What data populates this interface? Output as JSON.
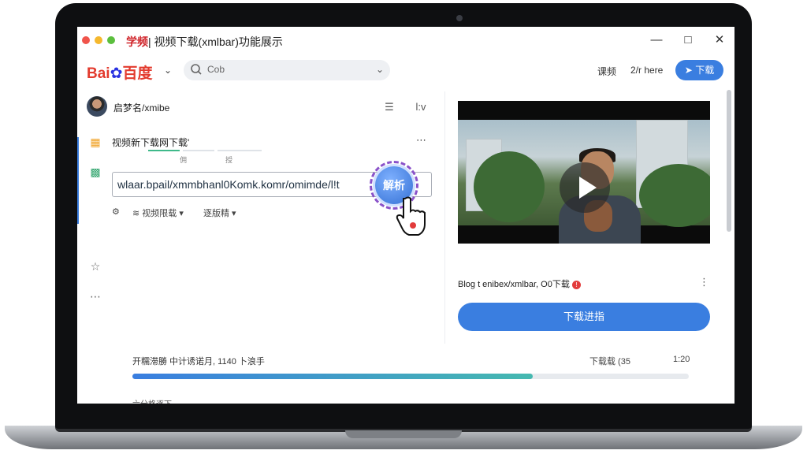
{
  "window": {
    "title_logo": "学频",
    "title": "| 视频下载(xmlbar)功能展示",
    "minimize_icon": "minimize-icon",
    "maximize_icon": "maximize-icon",
    "close_icon": "close-icon"
  },
  "nav": {
    "brand_left": "Bai",
    "brand_right": "百度",
    "search_text": "Cob",
    "link1": "课频",
    "link2": "2/r here",
    "download_label": "下载"
  },
  "user": {
    "name": "启梦名/xmibe",
    "action_right": "l:v"
  },
  "card": {
    "title": "视频新下载网下载'",
    "mini_label_1": "佣",
    "mini_label_2": "授",
    "url_value": "wlaar.bpail/xmmbhanl0Komk.komr/omimde/l!t",
    "parse_label": "解析",
    "option_1": "视频限载",
    "option_2": "逐版精"
  },
  "video": {
    "title": "Blog t enibex/xmlbar, O0下载",
    "download_progress_label": "下载进指"
  },
  "progress": {
    "label": "开糯滞勝 中计诱诺月, 1140 卜浪手",
    "right_label": "下载载 (35",
    "right_value": "1:20",
    "percent": 0.72,
    "bottom_label": "六分格逐下"
  },
  "colors": {
    "accent": "#3a7ee0",
    "progress_end": "#45b9b0",
    "parse_ring": "#8a52c9",
    "brand_red": "#e33b2e"
  }
}
